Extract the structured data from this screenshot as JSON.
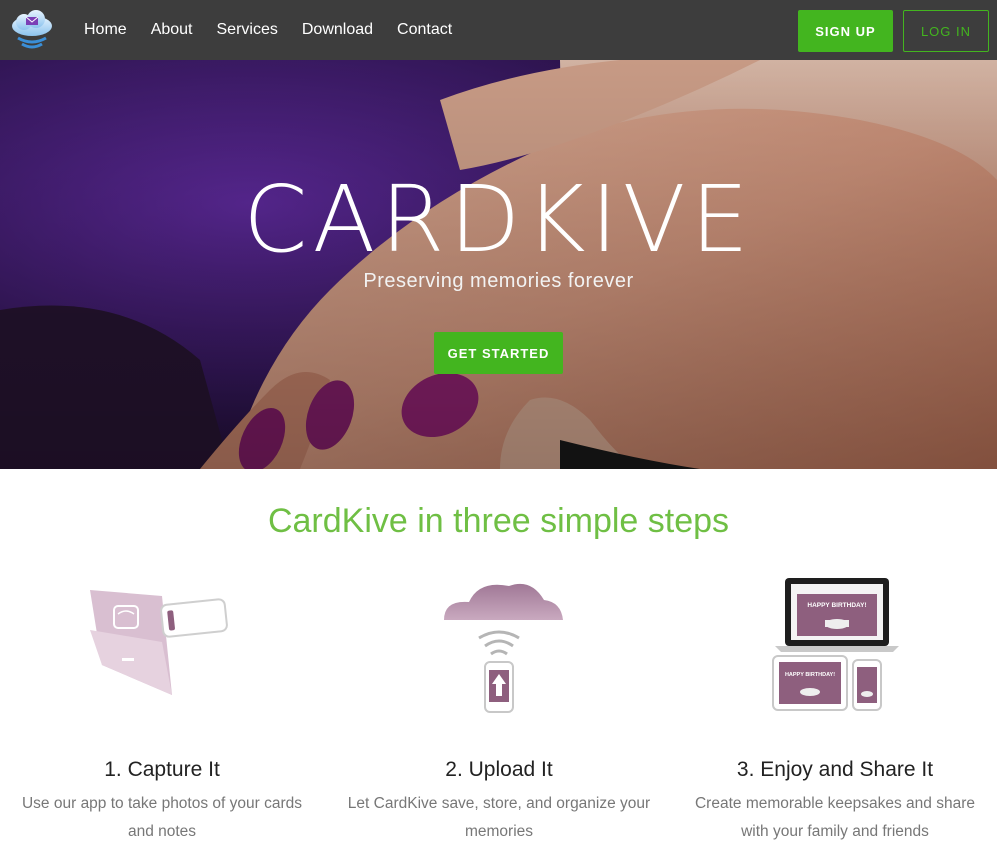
{
  "nav": {
    "items": [
      {
        "label": "Home"
      },
      {
        "label": "About"
      },
      {
        "label": "Services"
      },
      {
        "label": "Download"
      },
      {
        "label": "Contact"
      }
    ],
    "signup_label": "SIGN UP",
    "login_label": "LOG IN"
  },
  "hero": {
    "title": "CARDKIVE",
    "subtitle": "Preserving memories forever",
    "cta_label": "GET STARTED"
  },
  "steps": {
    "heading": "CardKive in three simple steps",
    "items": [
      {
        "title": "1. Capture It",
        "description": "Use our app to take photos of your cards and notes"
      },
      {
        "title": "2. Upload It",
        "description": "Let CardKive save, store, and organize your memories"
      },
      {
        "title": "3. Enjoy and Share It",
        "description": "Create memorable keepsakes and share with your family and friends"
      }
    ],
    "card_text": "HAPPY BIRTHDAY!"
  },
  "colors": {
    "accent": "#43b51f",
    "heading_green": "#6fbf44",
    "nav_bg": "#3d3d3d",
    "illustration_mauve": "#8e5f7e"
  }
}
